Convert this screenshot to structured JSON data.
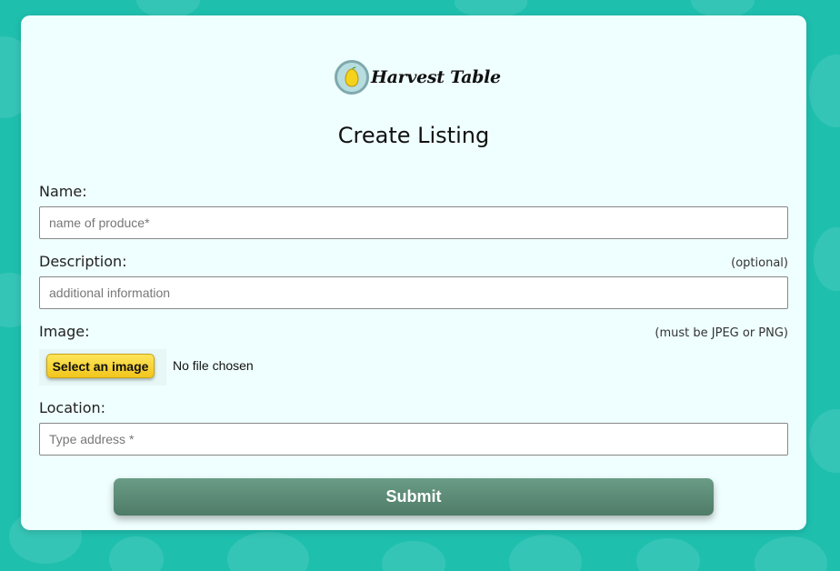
{
  "brand": {
    "name": "Harvest Table",
    "logo_icon": "lemon-icon"
  },
  "page": {
    "title": "Create Listing"
  },
  "form": {
    "name": {
      "label": "Name:",
      "placeholder": "name of produce*",
      "value": ""
    },
    "description": {
      "label": "Description:",
      "hint": "(optional)",
      "placeholder": "additional information",
      "value": ""
    },
    "image": {
      "label": "Image:",
      "hint": "(must be JPEG or PNG)",
      "button_label": "Select an image",
      "status": "No file chosen"
    },
    "location": {
      "label": "Location:",
      "placeholder": "Type address *",
      "value": ""
    },
    "submit_label": "Submit"
  },
  "colors": {
    "background": "#1fbfae",
    "card": "#effefe",
    "submit": "#5b8a74",
    "file_button": "#f5cd28"
  }
}
